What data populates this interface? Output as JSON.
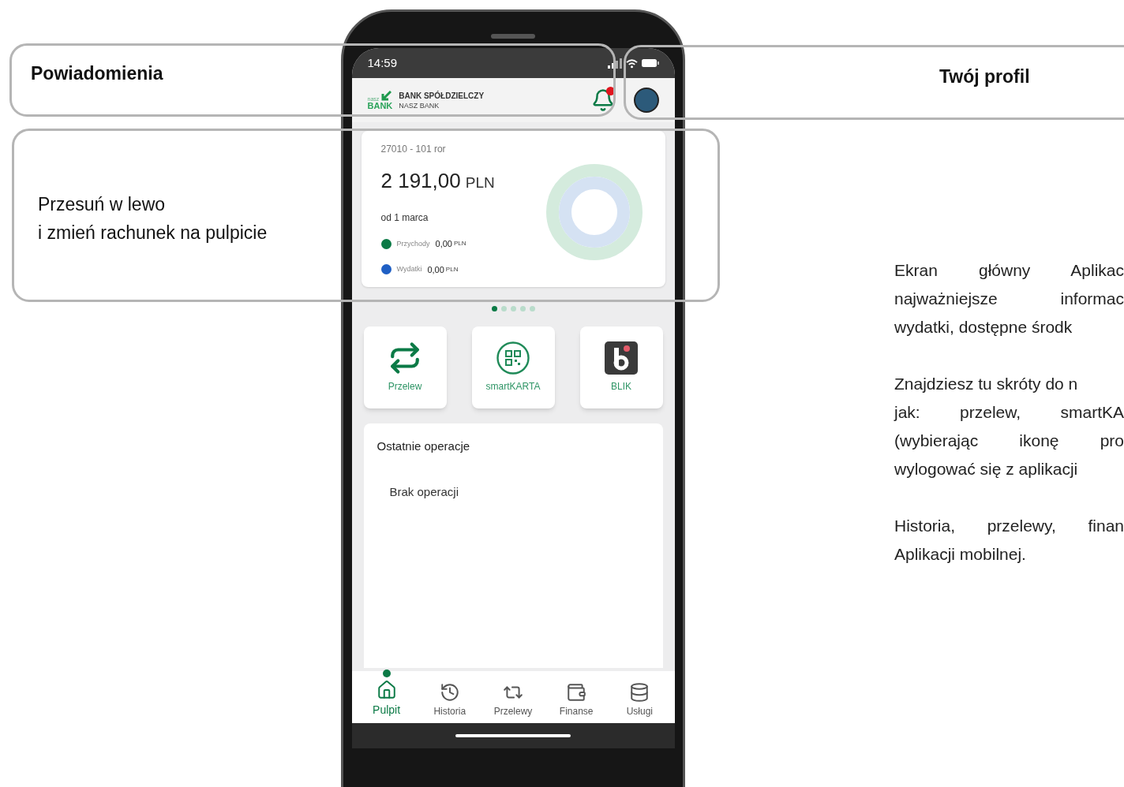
{
  "callouts": [
    {
      "kind": "notifications",
      "label": "Powiadomienia"
    },
    {
      "kind": "profile",
      "label": "Twój profil"
    },
    {
      "kind": "swipe",
      "label": "Przesuń w lewo\ni zmień rachunek na pulpicie"
    }
  ],
  "status_bar": {
    "time": "14:59"
  },
  "header": {
    "logo_small": "nasz",
    "logo_big": "BANK",
    "bank_name": "BANK SPÓŁDZIELCZY",
    "bank_sub": "NASZ BANK",
    "notification_badge": true
  },
  "account_card": {
    "account": "27010 - 101 ror",
    "amount": "2 191,00",
    "currency": "PLN",
    "period": "od 1 marca",
    "legend": [
      {
        "label": "Przychody",
        "amount": "0,00",
        "currency": "PLN",
        "color": "#0b7a46"
      },
      {
        "label": "Wydatki",
        "amount": "0,00",
        "currency": "PLN",
        "color": "#1f5fc4"
      }
    ]
  },
  "pager": [
    {
      "selected": true
    },
    {
      "selected": false
    },
    {
      "selected": false
    },
    {
      "selected": false
    },
    {
      "selected": false
    }
  ],
  "shortcuts": [
    {
      "kind": "transfer",
      "label": "Przelew"
    },
    {
      "kind": "qr",
      "label": "smartKARTA"
    },
    {
      "kind": "blik",
      "label": "BLIK"
    }
  ],
  "recent": {
    "title": "Ostatnie operacje",
    "empty": "Brak operacji"
  },
  "nav": [
    {
      "kind": "home",
      "label": "Pulpit",
      "selected": true
    },
    {
      "kind": "history",
      "label": "Historia",
      "selected": false
    },
    {
      "kind": "transfers",
      "label": "Przelewy",
      "selected": false
    },
    {
      "kind": "finance",
      "label": "Finanse",
      "selected": false
    },
    {
      "kind": "services",
      "label": "Usługi",
      "selected": false
    }
  ],
  "description": [
    [
      {
        "text": "Ekran główny Aplikac",
        "justify": true
      },
      {
        "text": "najważniejsze informac",
        "justify": true
      },
      {
        "text": "wydatki, dostępne środk",
        "justify": false
      }
    ],
    [
      {
        "text": "Znajdziesz tu skróty do n",
        "justify": false
      },
      {
        "text": "jak: przelew, smartKA",
        "justify": true
      },
      {
        "text": "(wybierając ikonę pro",
        "justify": true
      },
      {
        "text": "wylogować się z aplikacji",
        "justify": false
      }
    ],
    [
      {
        "text": "Historia, przelewy, finan",
        "justify": true
      },
      {
        "text": "Aplikacji mobilnej.",
        "justify": false
      }
    ]
  ]
}
